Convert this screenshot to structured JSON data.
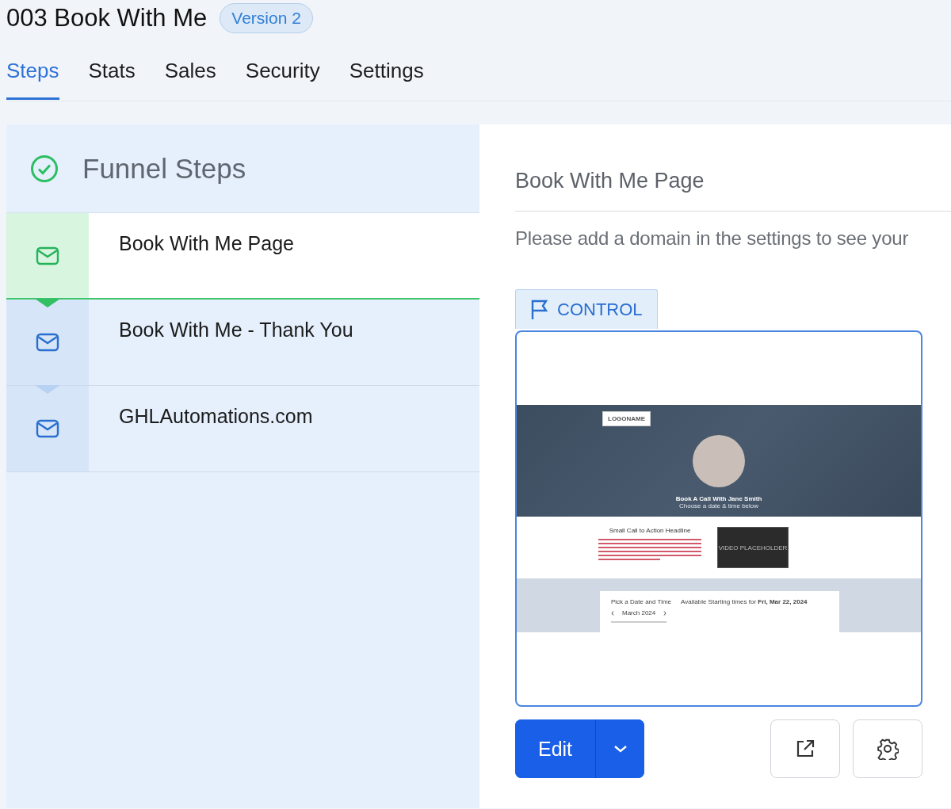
{
  "title": "003 Book With Me",
  "version_badge": "Version 2",
  "tabs": [
    {
      "label": "Steps",
      "selected": true
    },
    {
      "label": "Stats",
      "selected": false
    },
    {
      "label": "Sales",
      "selected": false
    },
    {
      "label": "Security",
      "selected": false
    },
    {
      "label": "Settings",
      "selected": false
    }
  ],
  "funnel": {
    "heading": "Funnel Steps",
    "steps": [
      {
        "name": "Book With Me Page",
        "selected": true
      },
      {
        "name": "Book With Me - Thank You",
        "selected": false
      },
      {
        "name": "GHLAutomations.com",
        "selected": false
      }
    ]
  },
  "detail": {
    "title": "Book With Me Page",
    "notice": "Please add a domain in the settings to see your",
    "tag": "CONTROL",
    "preview": {
      "logo": "LOGONAME",
      "headline": "Book A Call With Jane Smith",
      "subheadline": "Choose a date & time below",
      "cta_headline": "Small Call to Action Headline",
      "video_label": "VIDEO PLACEHOLDER",
      "calendar_title": "Pick a Date and Time",
      "availability": "Available Starting times for **Fri, Mar 22, 2024**",
      "month": "March",
      "year": "2024"
    },
    "edit_button": "Edit"
  }
}
